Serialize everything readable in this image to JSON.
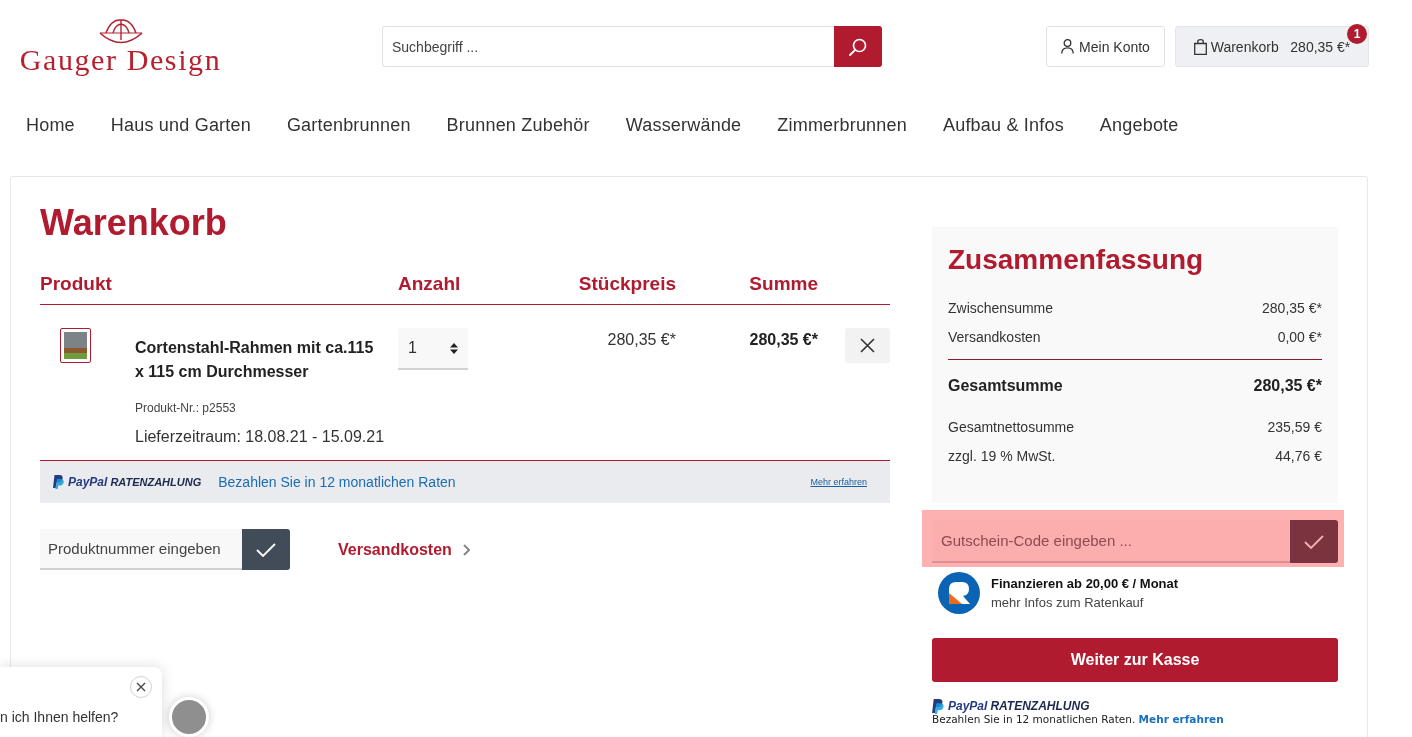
{
  "header": {
    "logo": "Gauger Design",
    "search": {
      "placeholder": "Suchbegriff ..."
    },
    "account": "Mein Konto",
    "cart": {
      "label": "Warenkorb",
      "total": "280,35 €*",
      "count": "1"
    }
  },
  "nav": [
    "Home",
    "Haus und Garten",
    "Gartenbrunnen",
    "Brunnen Zubehör",
    "Wasserwände",
    "Zimmerbrunnen",
    "Aufbau & Infos",
    "Angebote"
  ],
  "cart": {
    "title": "Warenkorb",
    "columns": [
      "Produkt",
      "Anzahl",
      "Stückpreis",
      "Summe"
    ],
    "items": [
      {
        "name": "Cortenstahl-Rahmen mit ca.115 x 115 cm Durchmesser",
        "product_number": "Produkt-Nr.: p2553",
        "delivery": "Lieferzeitraum: 18.08.21 - 15.09.21",
        "quantity": "1",
        "unit_price": "280,35 €*",
        "total": "280,35 €*"
      }
    ],
    "installment_banner": {
      "brand": "PayPal",
      "product": "RATENZAHLUNG",
      "text": "Bezahlen Sie in 12 monatlichen Raten",
      "link": "Mehr erfahren"
    },
    "product_number_field": {
      "placeholder": "Produktnummer eingeben"
    },
    "shipping_link": "Versandkosten"
  },
  "summary": {
    "title": "Zusammenfassung",
    "rows": [
      {
        "label": "Zwischensumme",
        "value": "280,35 €*",
        "kind": "line"
      },
      {
        "label": "Versandkosten",
        "value": "0,00 €*",
        "kind": "line"
      },
      {
        "label": "Gesamtsumme",
        "value": "280,35 €*",
        "kind": "total"
      },
      {
        "label": "Gesamtnettosumme",
        "value": "235,59 €",
        "kind": "line"
      },
      {
        "label": "zzgl. 19 % MwSt.",
        "value": "44,76 €",
        "kind": "line"
      }
    ]
  },
  "voucher": {
    "placeholder": "Gutschein-Code eingeben ...",
    "highlighted": true
  },
  "financing": {
    "title": "Finanzieren ab 20,00 € / Monat",
    "link": "mehr Infos zum Ratenkauf"
  },
  "checkout_button": "Weiter zur Kasse",
  "installment_note": {
    "brand": "PayPal",
    "product": "RATENZAHLUNG",
    "text": "Bezahlen Sie in 12 monatlichen Raten.",
    "link": "Mehr erfahren"
  },
  "chat": {
    "message": "n ich Ihnen helfen?"
  }
}
